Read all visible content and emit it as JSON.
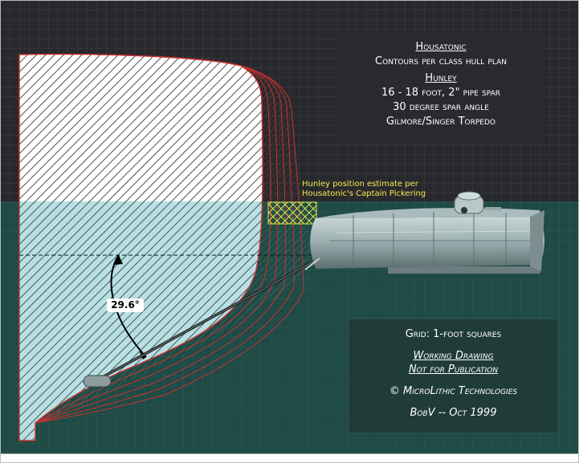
{
  "title_box": {
    "ship_name": "Housatonic",
    "ship_desc": "Contours per class hull plan",
    "sub_name": "Hunley",
    "spar_length": "16 - 18 foot, 2\" pipe spar",
    "spar_angle": "30 degree spar angle",
    "torpedo": "Gilmore/Singer Torpedo"
  },
  "note": {
    "line1": "Hunley position estimate per",
    "line2": "Housatonic's Captain Pickering"
  },
  "angle_label": "29.6°",
  "info_box": {
    "grid": "Grid: 1-foot squares",
    "working1": "Working Drawing",
    "working2": "Not for Publication",
    "copyright": "© MicroLithic Technologies",
    "author": "BobV -- Oct 1999"
  },
  "colors": {
    "sky": "#28292d",
    "water": "#1f4a45",
    "grid": "#3a3c42",
    "hull_outline": "#c8322f",
    "note_text": "#f2e84a",
    "submarine": "#8fa3a5"
  }
}
